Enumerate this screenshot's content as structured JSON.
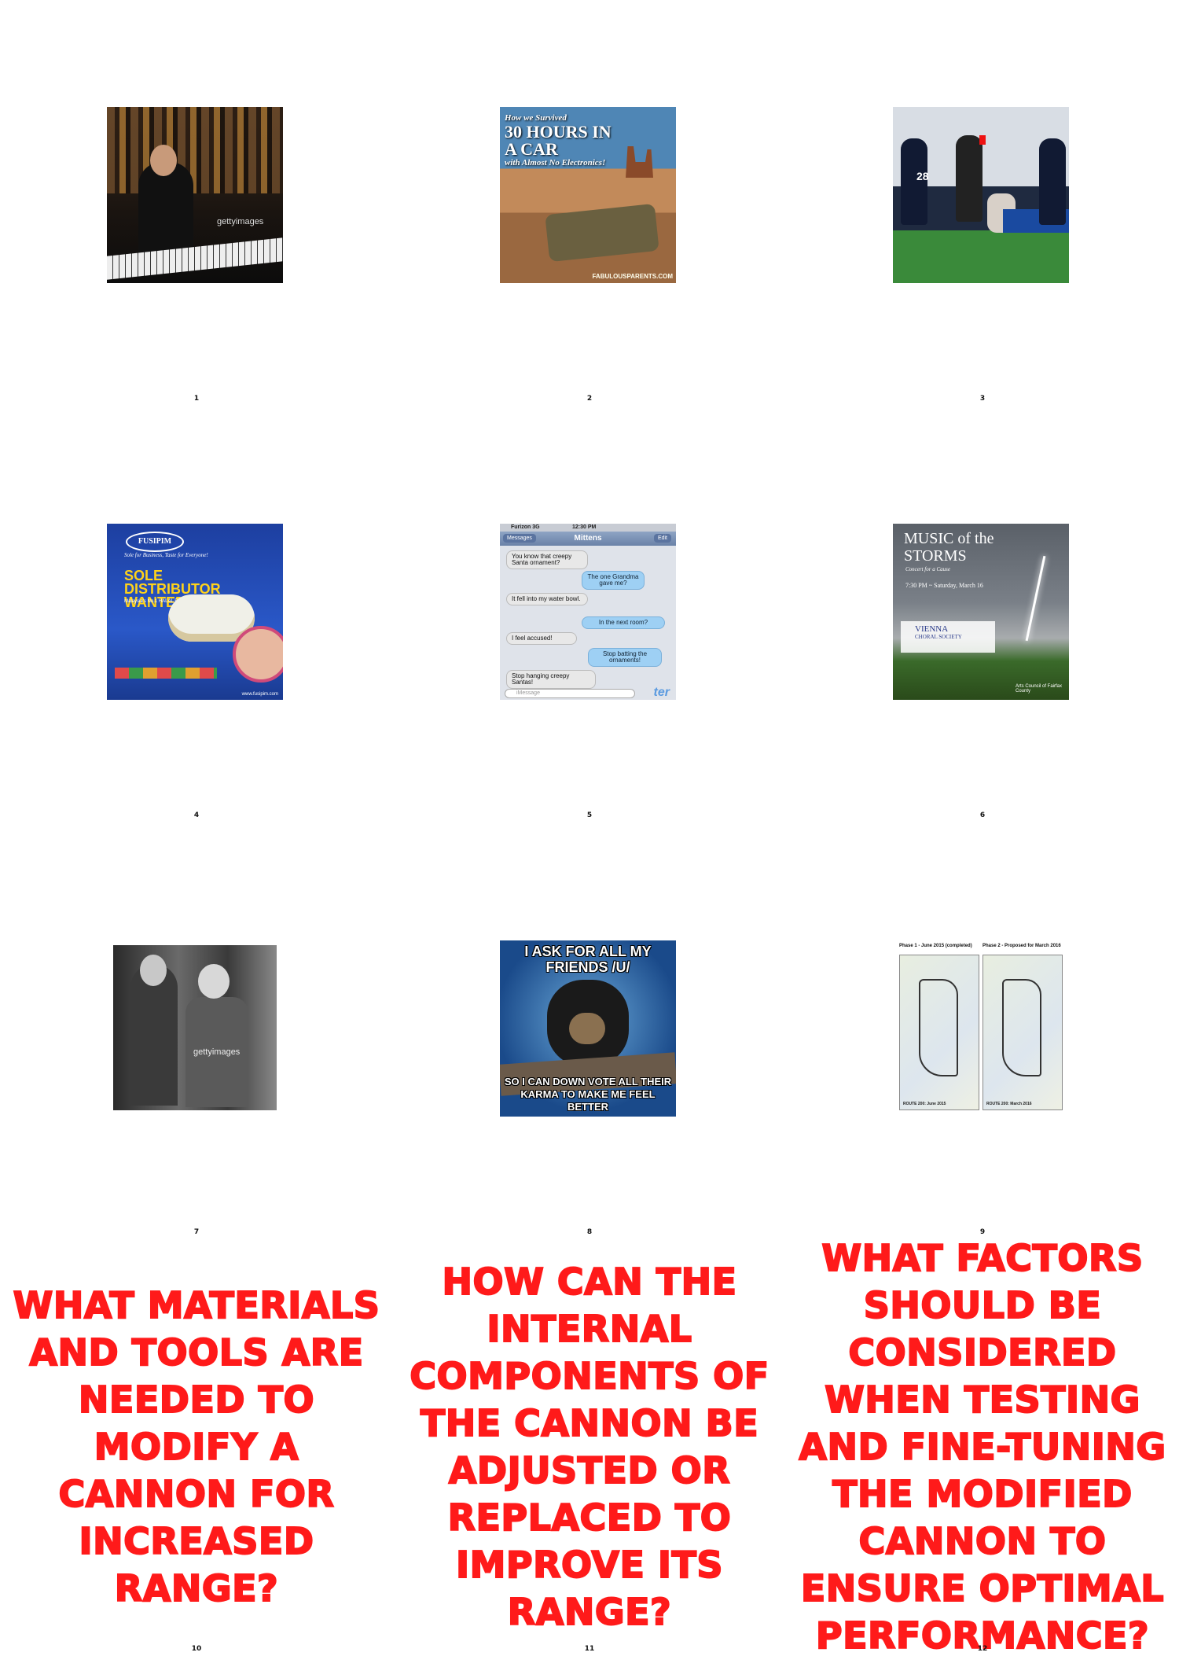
{
  "cells": [
    {
      "number": "1",
      "kind": "image",
      "icon": "musician-photo",
      "watermark": "gettyimages"
    },
    {
      "number": "2",
      "kind": "image",
      "icon": "desert-car-photo",
      "title": "30 HOURS IN A CAR",
      "subtitle_top": "How we Survived",
      "subtitle_bottom": "with Almost No Electronics!",
      "site": "FABULOUSPARENTS.COM"
    },
    {
      "number": "3",
      "kind": "image",
      "icon": "football-referee-photo",
      "jersey": "28"
    },
    {
      "number": "4",
      "kind": "image",
      "icon": "food-advert",
      "logo": "FUSIPIM",
      "tagline": "Sole for Business, Taste for Everyone!",
      "headline": "SOLE DISTRIBUTOR WANTED!",
      "subhead": "Malaysia's No.1 HALAL Fish Ball Maker",
      "url": "www.fusipim.com"
    },
    {
      "number": "5",
      "kind": "image",
      "icon": "text-message-screenshot",
      "carrier": "Furizon 3G",
      "time": "12:30 PM",
      "back": "Messages",
      "contact": "Mittens",
      "edit": "Edit",
      "messages": [
        {
          "dir": "in",
          "text": "You know that creepy Santa ornament?"
        },
        {
          "dir": "out",
          "text": "The one Grandma gave me?"
        },
        {
          "dir": "in",
          "text": "It fell into my water bowl."
        },
        {
          "dir": "out",
          "text": "In the next room?"
        },
        {
          "dir": "in",
          "text": "I feel accused!"
        },
        {
          "dir": "out",
          "text": "Stop batting the ornaments!"
        },
        {
          "dir": "in",
          "text": "Stop hanging creepy Santas!"
        }
      ],
      "input_placeholder": "iMessage",
      "brand": "ter"
    },
    {
      "number": "6",
      "kind": "image",
      "icon": "concert-poster",
      "title": "MUSIC of the STORMS",
      "line1": "Concert for a Cause",
      "line2": "7:30 PM ~ Saturday, March 16",
      "org": "VIENNA",
      "org_sub": "CHORAL SOCIETY",
      "sponsor": "Arts Council of Fairfax County"
    },
    {
      "number": "7",
      "kind": "image",
      "icon": "vintage-bw-photo",
      "watermark": "gettyimages"
    },
    {
      "number": "8",
      "kind": "image",
      "icon": "confession-bear-meme",
      "top_text": "I ASK FOR ALL MY FRIENDS /U/",
      "bottom_text": "SO I CAN DOWN VOTE ALL THEIR KARMA TO MAKE ME FEEL BETTER"
    },
    {
      "number": "9",
      "kind": "image",
      "icon": "route-maps",
      "left_title": "Phase 1 - June 2015 (completed)",
      "right_title": "Phase 2 - Proposed for March 2016",
      "left_label": "ROUTE 200: June 2015",
      "right_label": "ROUTE 200: March 2016"
    },
    {
      "number": "10",
      "kind": "text",
      "text": "WHAT MATERIALS AND TOOLS ARE NEEDED TO MODIFY A CANNON FOR INCREASED RANGE?"
    },
    {
      "number": "11",
      "kind": "text",
      "text": "HOW CAN THE INTERNAL COMPONENTS OF THE CANNON BE ADJUSTED OR REPLACED TO IMPROVE ITS RANGE?"
    },
    {
      "number": "12",
      "kind": "text",
      "text": "WHAT FACTORS SHOULD BE CONSIDERED WHEN TESTING AND FINE-TUNING THE MODIFIED CANNON TO ENSURE OPTIMAL PERFORMANCE?"
    }
  ],
  "colors": {
    "question_text": "#ff1a1a",
    "background": "#ffffff"
  }
}
